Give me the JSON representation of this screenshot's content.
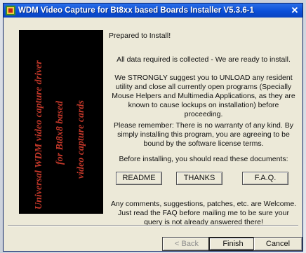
{
  "window": {
    "title": "WDM Video Capture for Bt8xx based Boards Installer V5.3.6-1",
    "close_glyph": "✕"
  },
  "banner": {
    "lines": [
      "Universal WDM video capture driver",
      "for Bt8x8 based",
      "video capture cards"
    ],
    "colors": {
      "background": "#000000",
      "text": "#c4382a"
    }
  },
  "panel": {
    "heading": "Prepared to Install!",
    "para1": "All data required is collected - We are ready to install.",
    "para2": "We STRONGLY suggest you to UNLOAD any resident utility and close all currently open programs (Specially Mouse Helpers and Multimedia Applications, as they are known to cause lockups on installation) before proceeding.",
    "para3": "Please remember: There is no warranty of any kind. By simply installing this program, you are agreeing to be bound by the software license terms.",
    "para4": "Before installing, you should read these documents:",
    "para5": "Any comments, suggestions, patches, etc. are Welcome. Just read the FAQ before mailing me to be sure your query is not already answered there!"
  },
  "docs": {
    "readme": "README",
    "thanks": "THANKS",
    "faq": "F.A.Q."
  },
  "footer": {
    "back": "< Back",
    "finish": "Finish",
    "cancel": "Cancel"
  },
  "colors": {
    "titlebar": "#0b4fd8",
    "face": "#ece9d8"
  },
  "icons": {
    "title": "installer-icon",
    "close": "close-icon"
  }
}
